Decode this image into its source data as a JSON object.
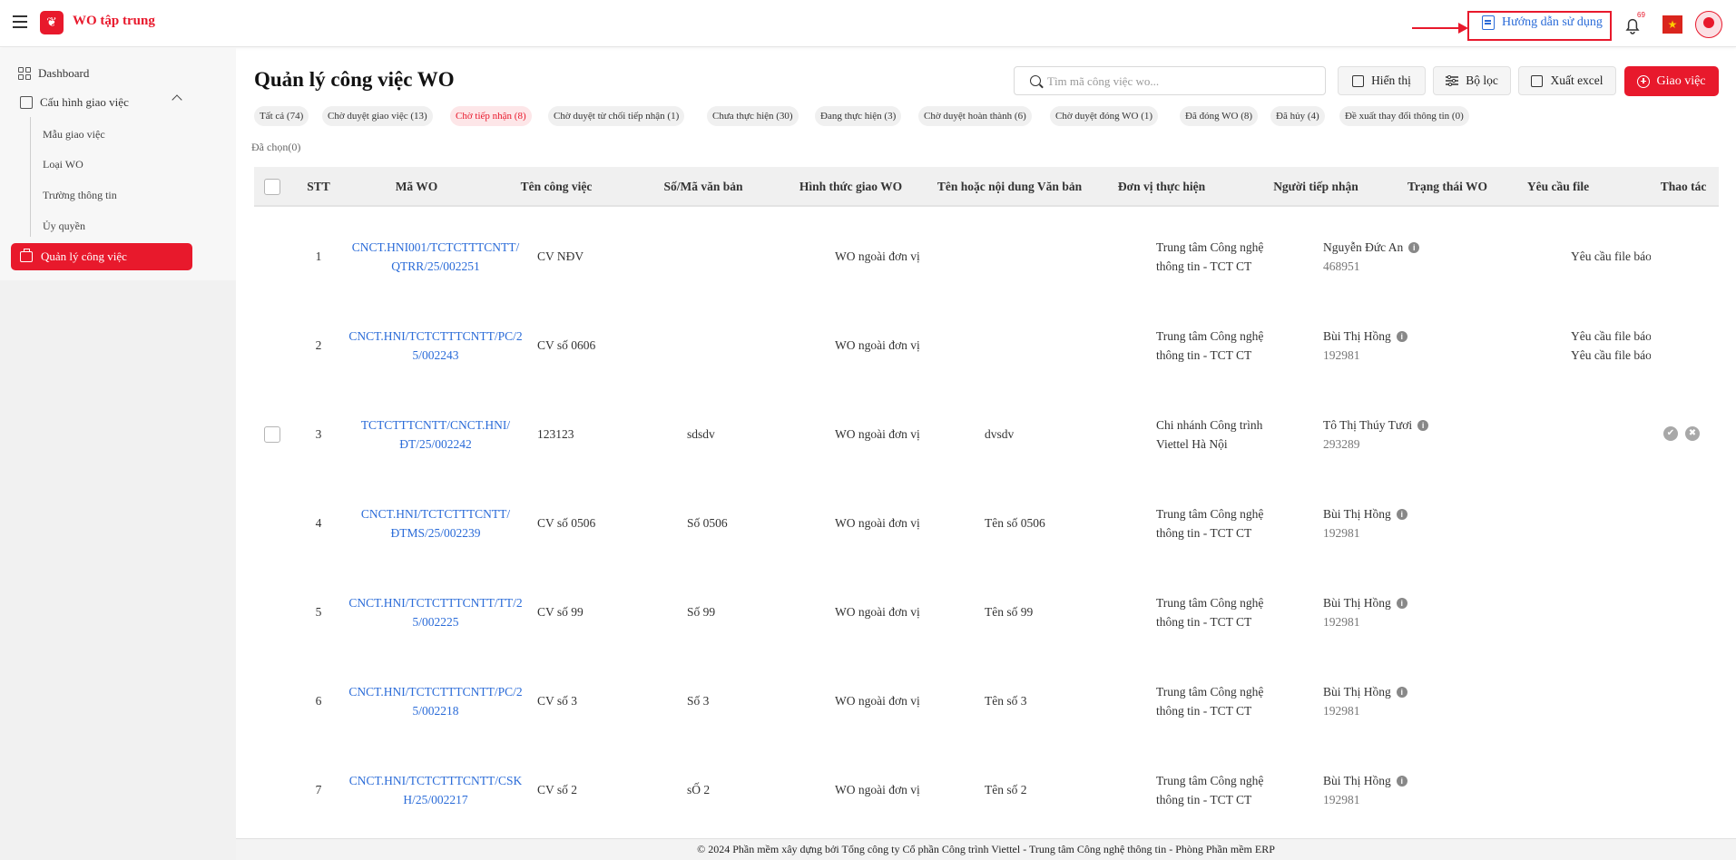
{
  "app": {
    "title": "WO tập trung",
    "logo_glyph": "❦"
  },
  "header": {
    "guide_label": "Hướng dẫn sử dụng",
    "notification_count": "69",
    "flag_glyph": "★"
  },
  "sidebar": {
    "dashboard": "Dashboard",
    "config_group": "Cấu hình giao việc",
    "sub_items": [
      "Mẫu giao việc",
      "Loại WO",
      "Trường thông tin",
      "Ủy quyền"
    ],
    "active_item": "Quản lý công việc"
  },
  "page": {
    "title": "Quản lý công việc WO",
    "search_placeholder": "Tìm mã công việc wo...",
    "buttons": {
      "display": "Hiển thị",
      "filter": "Bộ lọc",
      "export": "Xuất excel",
      "assign": "Giao việc"
    },
    "selected_label": "Đã chọn(0)"
  },
  "status_tabs": [
    "Tất cả (74)",
    "Chờ duyệt giao việc (13)",
    "Chờ tiếp nhận (8)",
    "Chờ duyệt từ chối tiếp nhận (1)",
    "Chưa thực hiện (30)",
    "Đang thực hiện (3)",
    "Chờ duyệt hoàn thành (6)",
    "Chờ duyệt đóng WO (1)",
    "Đã đóng WO (8)",
    "Đã hủy (4)",
    "Đề xuất thay đổi thông tin (0)"
  ],
  "active_tab_index": 2,
  "table": {
    "columns": [
      "STT",
      "Mã WO",
      "Tên công việc",
      "Số/Mã văn bản",
      "Hình thức giao WO",
      "Tên hoặc nội dung Văn bản",
      "Đơn vị thực hiện",
      "Người tiếp nhận",
      "Trạng thái WO",
      "Yêu cầu file",
      "Thao tác"
    ],
    "rows": [
      {
        "stt": "1",
        "code": [
          "CNCT.HNI001/TCTCTTTCNTT/",
          "QTRR/25/002251"
        ],
        "name": "CV NĐV",
        "doc_no": "",
        "form": "WO ngoài đơn vị",
        "doc_name": "",
        "unit": [
          "Trung tâm Công nghệ",
          "thông tin - TCT CT"
        ],
        "person": "Nguyễn Đức An",
        "emp_id": "468951",
        "status": "",
        "file_req": [
          "Yêu cầu file báo"
        ]
      },
      {
        "stt": "2",
        "code": [
          "CNCT.HNI/TCTCTTTCNTT/PC/2",
          "5/002243"
        ],
        "name": "CV số 0606",
        "doc_no": "",
        "form": "WO ngoài đơn vị",
        "doc_name": "",
        "unit": [
          "Trung tâm Công nghệ",
          "thông tin - TCT CT"
        ],
        "person": "Bùi Thị Hồng",
        "emp_id": "192981",
        "status": "",
        "file_req": [
          "Yêu cầu file báo",
          "Yêu cầu file báo"
        ]
      },
      {
        "stt": "3",
        "code": [
          "TCTCTTTCNTT/CNCT.HNI/",
          "ĐT/25/002242"
        ],
        "name": "123123",
        "doc_no": "sdsdv",
        "form": "WO ngoài đơn vị",
        "doc_name": "dvsdv",
        "unit": [
          "Chi nhánh Công trình",
          "Viettel Hà Nội"
        ],
        "person": "Tô Thị Thúy Tươi",
        "emp_id": "293289",
        "status": "",
        "file_req": []
      },
      {
        "stt": "4",
        "code": [
          "CNCT.HNI/TCTCTTTCNTT/",
          "ĐTMS/25/002239"
        ],
        "name": "CV số 0506",
        "doc_no": "Số 0506",
        "form": "WO ngoài đơn vị",
        "doc_name": "Tên số 0506",
        "unit": [
          "Trung tâm Công nghệ",
          "thông tin - TCT CT"
        ],
        "person": "Bùi Thị Hồng",
        "emp_id": "192981",
        "status": "",
        "file_req": []
      },
      {
        "stt": "5",
        "code": [
          "CNCT.HNI/TCTCTTTCNTT/TT/2",
          "5/002225"
        ],
        "name": "CV số 99",
        "doc_no": "Số 99",
        "form": "WO ngoài đơn vị",
        "doc_name": "Tên số 99",
        "unit": [
          "Trung tâm Công nghệ",
          "thông tin - TCT CT"
        ],
        "person": "Bùi Thị Hồng",
        "emp_id": "192981",
        "status": "",
        "file_req": []
      },
      {
        "stt": "6",
        "code": [
          "CNCT.HNI/TCTCTTTCNTT/PC/2",
          "5/002218"
        ],
        "name": "CV số 3",
        "doc_no": "Số 3",
        "form": "WO ngoài đơn vị",
        "doc_name": "Tên số 3",
        "unit": [
          "Trung tâm Công nghệ",
          "thông tin - TCT CT"
        ],
        "person": "Bùi Thị Hồng",
        "emp_id": "192981",
        "status": "",
        "file_req": []
      },
      {
        "stt": "7",
        "code": [
          "CNCT.HNI/TCTCTTTCNTT/CSK",
          "H/25/002217"
        ],
        "name": "CV số 2",
        "doc_no": "sỐ 2",
        "form": "WO ngoài đơn vị",
        "doc_name": "Tên số 2",
        "unit": [
          "Trung tâm Công nghệ",
          "thông tin - TCT CT"
        ],
        "person": "Bùi Thị Hồng",
        "emp_id": "192981",
        "status": "",
        "file_req": []
      }
    ],
    "row_actions": {
      "approve_glyph": "✔",
      "reject_glyph": "✖"
    }
  },
  "footer": {
    "text": "© 2024 Phần mềm xây dựng bởi Tổng công ty Cổ phần Công trình Viettel - Trung tâm Công nghệ thông tin - Phòng Phần mềm ERP"
  },
  "colors": {
    "brand_red": "#e8192c",
    "link_blue": "#2a6bd8"
  }
}
